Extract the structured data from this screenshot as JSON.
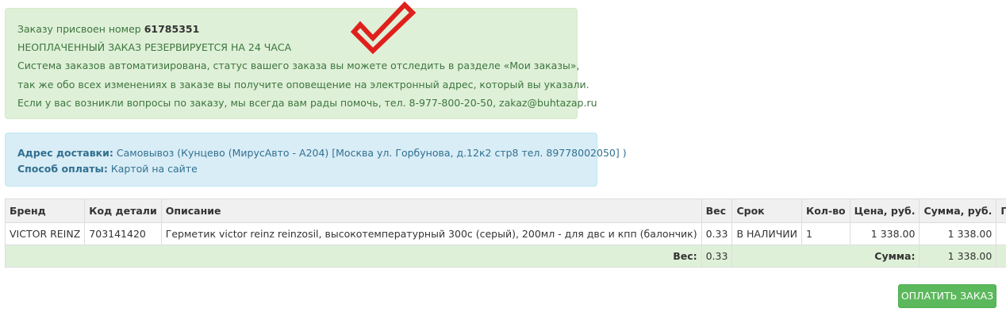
{
  "order_notice": {
    "number_prefix": "Заказу присвоен номер",
    "order_number": "61785351",
    "reserve_text": "НЕОПЛАЧЕННЫЙ ЗАКАЗ РЕЗЕРВИРУЕТСЯ НА 24 ЧАСА",
    "line_system": "Система заказов автоматизирована, статус вашего заказа вы можете отследить в разделе «Мои заказы»,",
    "line_notify": "так же обо всех изменениях в заказе вы получите оповещение на электронный адрес, который вы указали.",
    "line_contact": "Если у вас возникли вопросы по заказу, мы всегда вам рады помочь, тел. 8-977-800-20-50, zakaz@buhtazap.ru",
    "check_icon": "checkmark-icon",
    "check_color": "#e0201c"
  },
  "delivery": {
    "address_label": "Адрес доставки:",
    "address_value": "Самовывоз (Кунцево (МирусАвто - А204) [Москва ул. Горбунова, д.12к2 стр8 тел. 89778002050] )",
    "payment_label": "Способ оплаты:",
    "payment_value": "Картой на сайте"
  },
  "table": {
    "headers": [
      "Бренд",
      "Код детали",
      "Описание",
      "Вес",
      "Срок",
      "Кол-во",
      "Цена, руб.",
      "Сумма, руб.",
      "Прим."
    ],
    "rows": [
      {
        "brand": "VICTOR REINZ",
        "code": "703141420",
        "description": "Герметик victor reinz reinzosil, высокотемпературный 300c (серый), 200мл - для двс и кпп (балончик)",
        "weight": "0.33",
        "term": "В НАЛИЧИИ",
        "qty": "1",
        "price": "1 338.00",
        "sum": "1 338.00",
        "note": ""
      }
    ],
    "total": {
      "weight_label": "Вес:",
      "weight_value": "0.33",
      "sum_label": "Сумма:",
      "sum_value": "1 338.00"
    }
  },
  "pay_button": "ОПЛАТИТЬ ЗАКАЗ"
}
